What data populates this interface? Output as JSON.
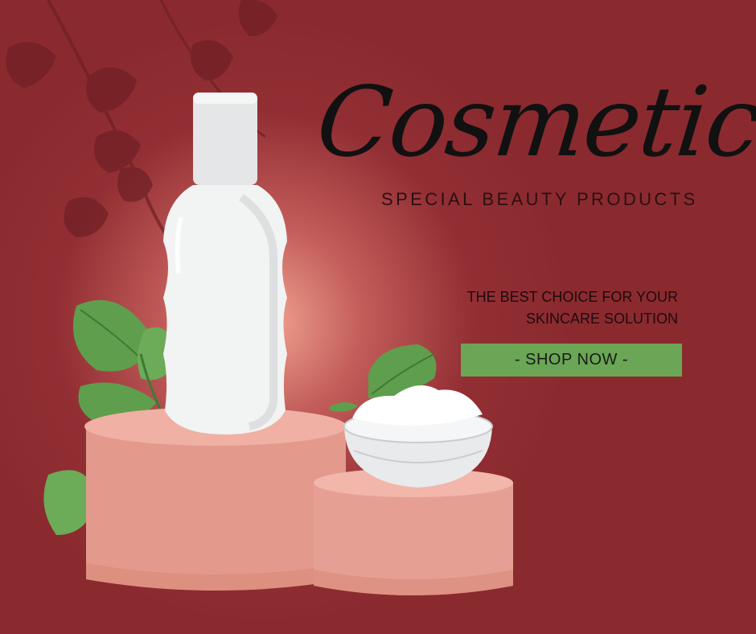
{
  "banner": {
    "title": "Cosmetic",
    "subtitle": "SPECIAL BEAUTY PRODUCTS",
    "tagline": [
      "THE BEST CHOICE FOR YOUR",
      "SKINCARE SOLUTION"
    ],
    "cta_label": "- SHOP NOW -"
  },
  "colors": {
    "background": "#8a2a2f",
    "glow": "#f6aa96",
    "button": "#6aa655",
    "podium": "#e8a294",
    "leaf": "#5f9e4c",
    "bottle": "#f2f3f3"
  },
  "icons": [
    "branch-silhouette-icon",
    "leaf-icon",
    "bottle-icon",
    "cream-jar-icon",
    "podium-icon"
  ]
}
